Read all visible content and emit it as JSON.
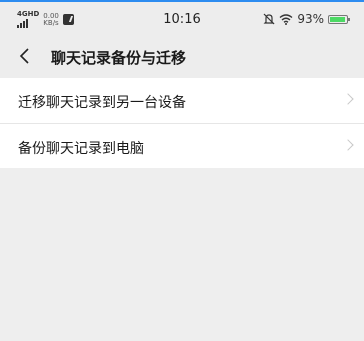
{
  "status_bar": {
    "network_type": "4G",
    "carrier_label": "HD",
    "net_speed_value": "0.00",
    "net_speed_unit": "KB/s",
    "time": "10:16",
    "battery_percent": "93%",
    "battery_level": 0.93,
    "icons": [
      "signal-icon",
      "notification-icon",
      "mute-icon",
      "wifi-icon",
      "battery-icon"
    ]
  },
  "header": {
    "back_icon": "chevron-left-icon",
    "title": "聊天记录备份与迁移"
  },
  "menu": {
    "items": [
      {
        "label": "迁移聊天记录到另一台设备",
        "icon": "chevron-right-icon"
      },
      {
        "label": "备份聊天记录到电脑",
        "icon": "chevron-right-icon"
      }
    ]
  },
  "colors": {
    "page_background": "#eeeeee",
    "accent_top_line": "#2d8cf0",
    "battery_fill": "#4cd964"
  }
}
